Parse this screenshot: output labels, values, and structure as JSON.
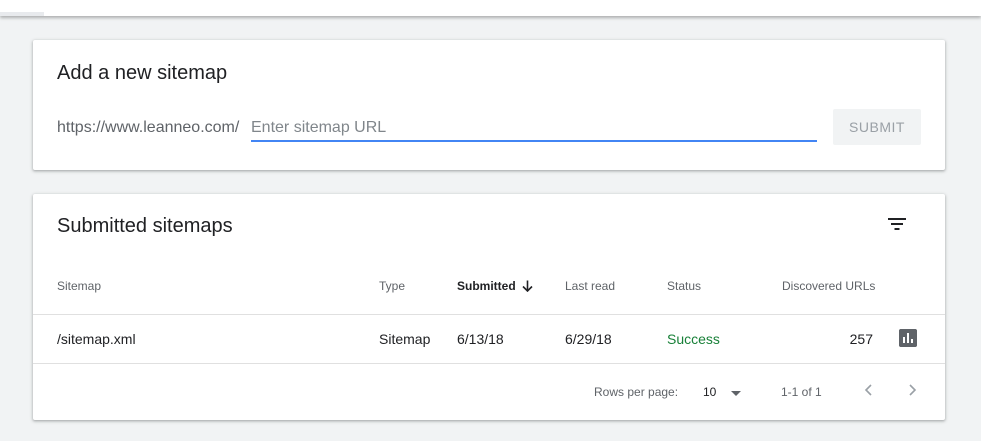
{
  "add_sitemap": {
    "title": "Add a new sitemap",
    "url_prefix": "https://www.leanneo.com/",
    "input_value": "",
    "input_placeholder": "Enter sitemap URL",
    "submit_label": "SUBMIT"
  },
  "submitted": {
    "title": "Submitted sitemaps",
    "columns": {
      "sitemap": "Sitemap",
      "type": "Type",
      "submitted": "Submitted",
      "last_read": "Last read",
      "status": "Status",
      "discovered_urls": "Discovered URLs"
    },
    "sort_column": "submitted",
    "sort_direction": "descending",
    "rows": [
      {
        "sitemap": "/sitemap.xml",
        "type": "Sitemap",
        "submitted": "6/13/18",
        "last_read": "6/29/18",
        "status": "Success",
        "discovered_urls": "257"
      }
    ],
    "pagination": {
      "rows_per_page_label": "Rows per page:",
      "rows_per_page_value": "10",
      "range_label": "1-1 of 1"
    }
  },
  "icons": {
    "filter": "filter-icon",
    "sort": "arrow-down-icon",
    "report": "bar-chart-icon",
    "dropdown": "caret-down-icon",
    "prev": "chevron-left-icon",
    "next": "chevron-right-icon"
  },
  "colors": {
    "accent": "#4285f4",
    "success": "#188038",
    "background": "#f1f3f4"
  }
}
